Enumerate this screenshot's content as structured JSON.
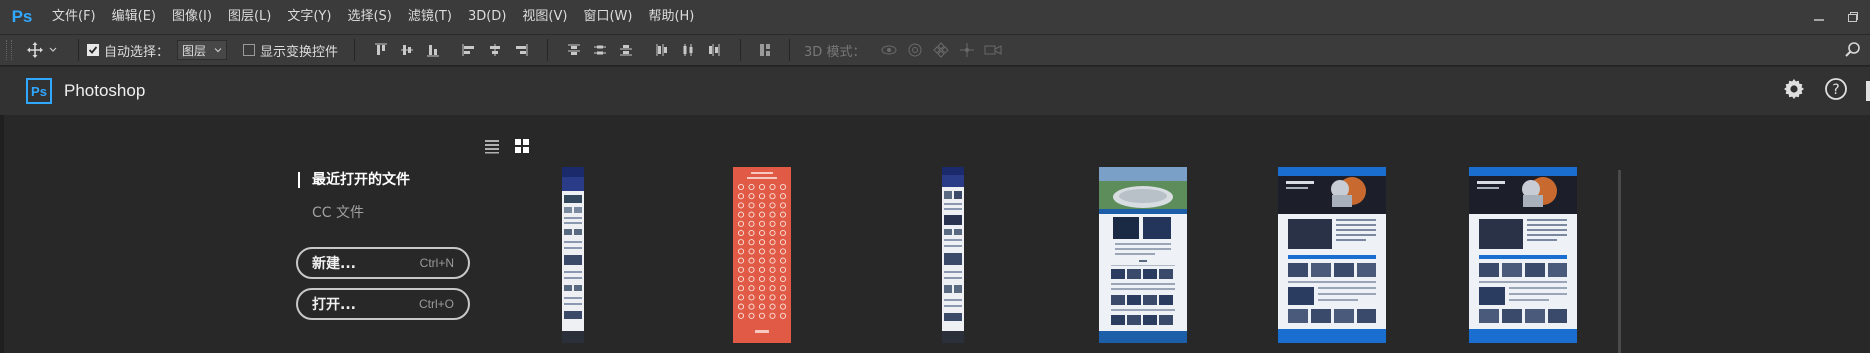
{
  "app": {
    "logo": "Ps",
    "name": "Photoshop"
  },
  "menu": {
    "items": [
      {
        "label": "文件(F)"
      },
      {
        "label": "编辑(E)"
      },
      {
        "label": "图像(I)"
      },
      {
        "label": "图层(L)"
      },
      {
        "label": "文字(Y)"
      },
      {
        "label": "选择(S)"
      },
      {
        "label": "滤镜(T)"
      },
      {
        "label": "3D(D)"
      },
      {
        "label": "视图(V)"
      },
      {
        "label": "窗口(W)"
      },
      {
        "label": "帮助(H)"
      }
    ]
  },
  "options": {
    "auto_select_label": "自动选择：",
    "auto_select_checked": true,
    "layer_select_value": "图层",
    "show_transform_label": "显示变换控件",
    "show_transform_checked": false,
    "mode_3d_label": "3D 模式："
  },
  "start": {
    "nav_recent": "最近打开的文件",
    "nav_cc": "CC 文件",
    "new_button": "新建...",
    "new_shortcut": "Ctrl+N",
    "open_button": "打开...",
    "open_shortcut": "Ctrl+O"
  },
  "recent_files": [
    {
      "kind": "long-page",
      "accent": "#1a2a6a"
    },
    {
      "kind": "icon-sheet",
      "accent": "#e05a45"
    },
    {
      "kind": "long-page",
      "accent": "#1a2a6a"
    },
    {
      "kind": "telescope-page",
      "accent": "#1c5fa8"
    },
    {
      "kind": "robot-page",
      "accent": "#1a6ed0"
    },
    {
      "kind": "robot-page",
      "accent": "#1a6ed0"
    }
  ],
  "colors": {
    "ps_blue": "#31a8ff",
    "bg": "#282828",
    "bar": "#3b3b3b"
  }
}
